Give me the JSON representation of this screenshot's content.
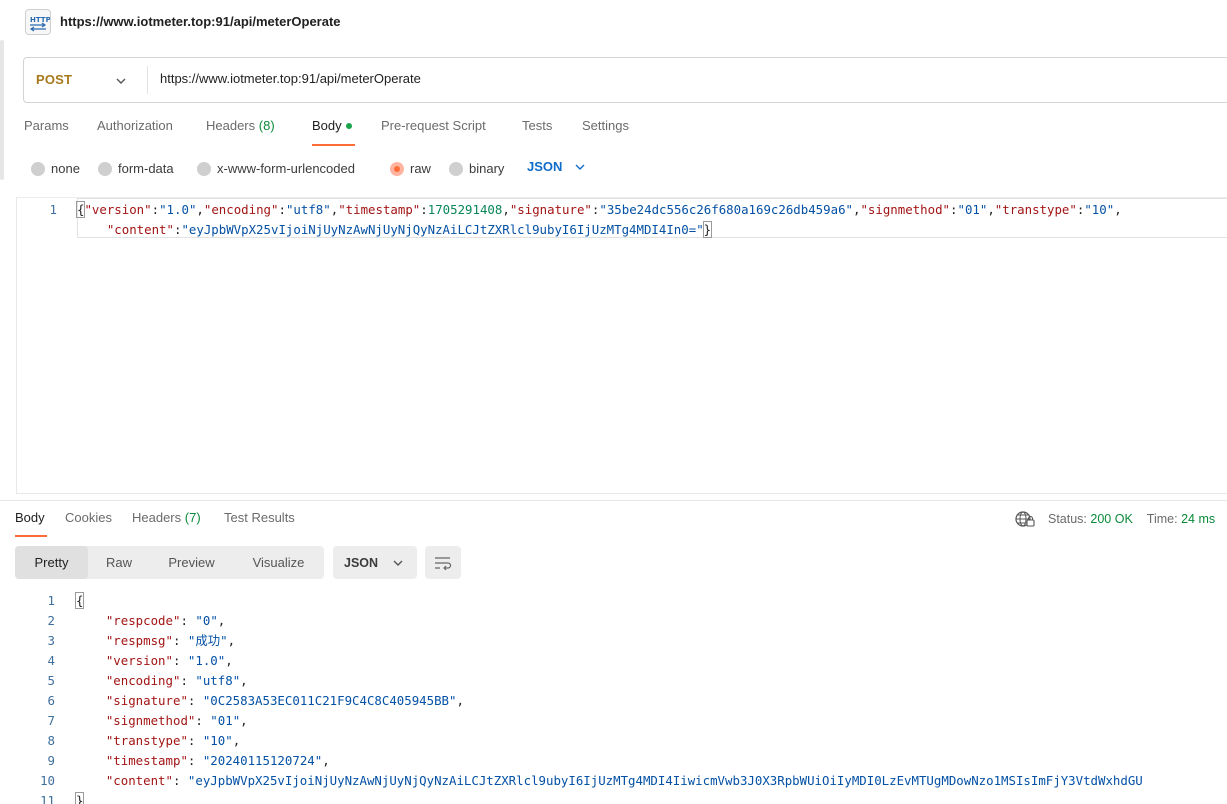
{
  "request": {
    "title": "https://www.iotmeter.top:91/api/meterOperate",
    "method": "POST",
    "url": "https://www.iotmeter.top:91/api/meterOperate"
  },
  "request_tabs": [
    {
      "label": "Params"
    },
    {
      "label": "Authorization"
    },
    {
      "label": "Headers",
      "count": "(8)"
    },
    {
      "label": "Body"
    },
    {
      "label": "Pre-request Script"
    },
    {
      "label": "Tests"
    },
    {
      "label": "Settings"
    }
  ],
  "body_types": [
    "none",
    "form-data",
    "x-www-form-urlencoded",
    "raw",
    "binary"
  ],
  "body_type_selected": "raw",
  "body_language": "JSON",
  "request_body": {
    "line_numbers": [
      "1"
    ],
    "version": "1.0",
    "encoding": "utf8",
    "timestamp": "1705291408",
    "signature": "35be24dc556c26f680a169c26db459a6",
    "signmethod": "01",
    "transtype": "10",
    "content": "eyJpbWVpX25vIjoiNjUyNzAwNjUyNjQyNzAiLCJtZXRlcl9ubyI6IjUzMTg4MDI4In0="
  },
  "response_tabs": [
    {
      "label": "Body"
    },
    {
      "label": "Cookies"
    },
    {
      "label": "Headers",
      "count": "(7)"
    },
    {
      "label": "Test Results"
    }
  ],
  "status": {
    "status_label": "Status:",
    "status_value": "200 OK",
    "time_label": "Time:",
    "time_value": "24 ms"
  },
  "response_views": [
    "Pretty",
    "Raw",
    "Preview",
    "Visualize"
  ],
  "response_view_selected": "Pretty",
  "response_format": "JSON",
  "response_body": {
    "line_numbers": [
      "1",
      "2",
      "3",
      "4",
      "5",
      "6",
      "7",
      "8",
      "9",
      "10",
      "11"
    ],
    "respcode": "0",
    "respmsg": "成功",
    "version": "1.0",
    "encoding": "utf8",
    "signature": "0C2583A53EC011C21F9C4C8C405945BB",
    "signmethod": "01",
    "transtype": "10",
    "timestamp": "20240115120724",
    "content": "eyJpbWVpX25vIjoiNjUyNzAwNjUyNjQyNzAiLCJtZXRlcl9ubyI6IjUzMTg4MDI4IiwicmVwb3J0X3RpbWUiOiIyMDI0LzEvMTUgMDowNzo1MSIsImFjY3VtdWxhdGU"
  }
}
